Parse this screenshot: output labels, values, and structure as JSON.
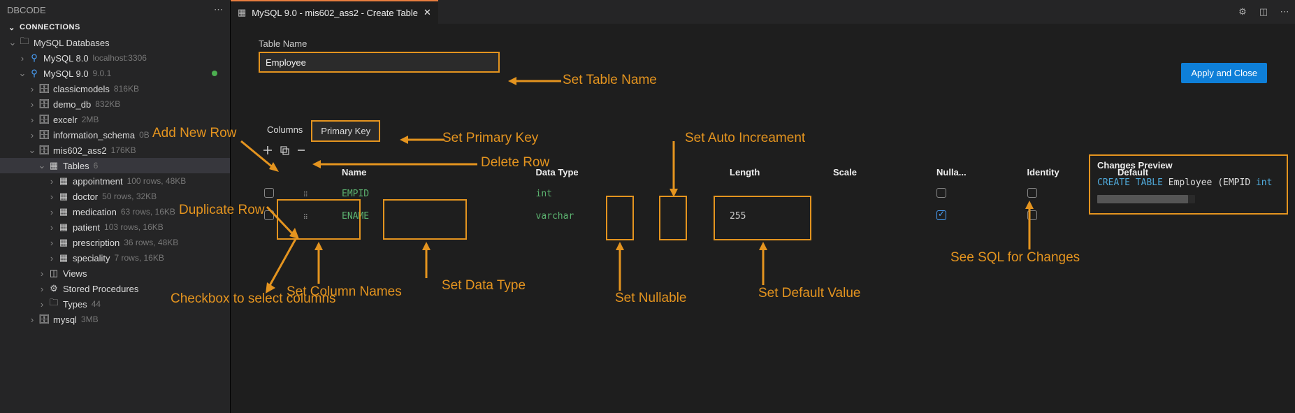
{
  "sidebar": {
    "panel_title": "DBCODE",
    "section_title": "CONNECTIONS",
    "root_label": "MySQL Databases",
    "connections": [
      {
        "label": "MySQL 8.0",
        "meta": "localhost:3306",
        "open": false
      },
      {
        "label": "MySQL 9.0",
        "meta": "9.0.1",
        "open": true,
        "online": true
      }
    ],
    "databases": [
      {
        "label": "classicmodels",
        "meta": "816KB"
      },
      {
        "label": "demo_db",
        "meta": "832KB"
      },
      {
        "label": "excelr",
        "meta": "2MB"
      },
      {
        "label": "information_schema",
        "meta": "0B"
      },
      {
        "label": "mis602_ass2",
        "meta": "176KB",
        "open": true
      }
    ],
    "tables_label": "Tables",
    "tables_count": "6",
    "tables": [
      {
        "label": "appointment",
        "meta": "100 rows, 48KB"
      },
      {
        "label": "doctor",
        "meta": "50 rows, 32KB"
      },
      {
        "label": "medication",
        "meta": "63 rows, 16KB"
      },
      {
        "label": "patient",
        "meta": "103 rows, 16KB"
      },
      {
        "label": "prescription",
        "meta": "36 rows, 48KB"
      },
      {
        "label": "speciality",
        "meta": "7 rows, 16KB"
      }
    ],
    "views_label": "Views",
    "procs_label": "Stored Procedures",
    "types_label": "Types",
    "types_count": "44",
    "mysqlsys_label": "mysql",
    "mysqlsys_meta": "3MB"
  },
  "tab": {
    "title": "MySQL 9.0 - mis602_ass2 - Create Table"
  },
  "apply_label": "Apply and Close",
  "tname": {
    "label": "Table Name",
    "value": "Employee"
  },
  "tabs": {
    "columns": "Columns",
    "pk": "Primary Key"
  },
  "headers": {
    "name": "Name",
    "datatype": "Data Type",
    "length": "Length",
    "scale": "Scale",
    "nullable": "Nulla...",
    "identity": "Identity",
    "default": "Default"
  },
  "rows": [
    {
      "name": "EMPID",
      "datatype": "int",
      "length": "",
      "nullable": false,
      "identity": false
    },
    {
      "name": "ENAME",
      "datatype": "varchar",
      "length": "255",
      "nullable": true,
      "identity": false
    }
  ],
  "changes": {
    "title": "Changes Preview",
    "kw1": "CREATE TABLE",
    "ident": "Employee (EMPID",
    "typ": "int"
  },
  "annotations": {
    "add_row": "Add New Row",
    "dup_row": "Duplicate Row",
    "checkbox": "Checkbox to select columns",
    "col_names": "Set Column Names",
    "data_type": "Set Data Type",
    "table_name": "Set Table Name",
    "pk": "Set Primary Key",
    "del_row": "Delete Row",
    "nullable": "Set Nullable",
    "auto_inc": "Set Auto Increament",
    "default": "Set Default Value",
    "sql": "See SQL for Changes"
  }
}
